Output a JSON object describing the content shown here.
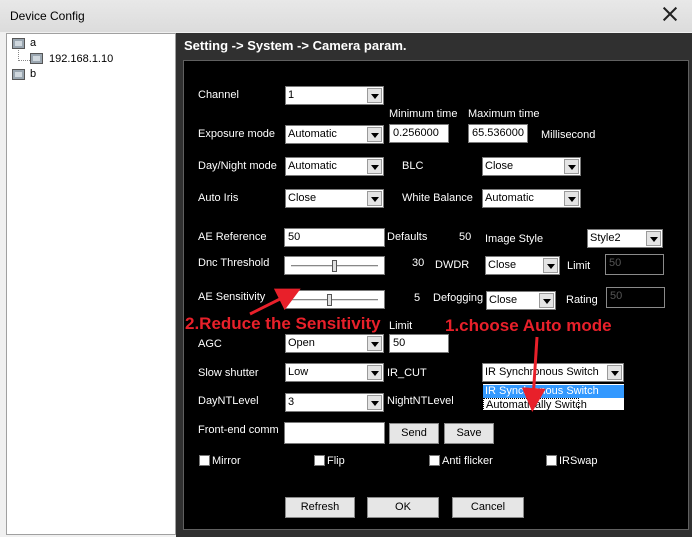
{
  "window": {
    "title": "Device Config"
  },
  "tree": {
    "nodes": [
      {
        "label": "a"
      },
      {
        "label": "192.168.1.10"
      },
      {
        "label": "b"
      }
    ]
  },
  "header": {
    "path": "Setting -> System -> Camera param."
  },
  "form": {
    "channel": {
      "label": "Channel",
      "value": "1"
    },
    "exposure": {
      "label": "Exposure mode",
      "value": "Automatic",
      "min_label": "Minimum time",
      "min_value": "0.256000",
      "max_label": "Maximum time",
      "max_value": "65.536000",
      "unit": "Millisecond"
    },
    "day_night": {
      "label": "Day/Night mode",
      "value": "Automatic"
    },
    "blc": {
      "label": "BLC",
      "value": "Close"
    },
    "auto_iris": {
      "label": "Auto Iris",
      "value": "Close"
    },
    "white_balance": {
      "label": "White Balance",
      "value": "Automatic"
    },
    "ae_reference": {
      "label": "AE Reference",
      "value": "50",
      "defaults_label": "Defaults",
      "defaults_value": "50"
    },
    "image_style": {
      "label": "Image Style",
      "value": "Style2"
    },
    "dnc_threshold": {
      "label": "Dnc Threshold",
      "value": "30",
      "level": 0.5
    },
    "dwdr": {
      "label": "DWDR",
      "value": "Close",
      "limit_label": "Limit",
      "limit_value": "50"
    },
    "ae_sensitivity": {
      "label": "AE Sensitivity",
      "value": "5",
      "level": 0.45
    },
    "defogging": {
      "label": "Defogging",
      "value": "Close",
      "rating_label": "Rating",
      "rating_value": "50"
    },
    "agc": {
      "label": "AGC",
      "value": "Open",
      "limit_label": "Limit",
      "limit_value": "50"
    },
    "slow_shutter": {
      "label": "Slow shutter",
      "value": "Low"
    },
    "ir_cut": {
      "label": "IR_CUT",
      "value": "IR Synchronous Switch",
      "options": [
        "IR Synchronous Switch",
        "Automatically Switch"
      ]
    },
    "day_nt_level": {
      "label": "DayNTLevel",
      "value": "3"
    },
    "night_nt_level": {
      "label": "NightNTLevel"
    },
    "front_end": {
      "label": "Front-end comm",
      "value": "",
      "send_label": "Send",
      "save_label": "Save"
    },
    "checkboxes": {
      "mirror": "Mirror",
      "flip": "Flip",
      "anti_flicker": "Anti flicker",
      "irswap": "IRSwap"
    }
  },
  "buttons": {
    "refresh": "Refresh",
    "ok": "OK",
    "cancel": "Cancel"
  },
  "annotations": {
    "step2": "2.Reduce the Sensitivity",
    "step1": "1.choose Auto mode",
    "color": "#e8202a"
  }
}
